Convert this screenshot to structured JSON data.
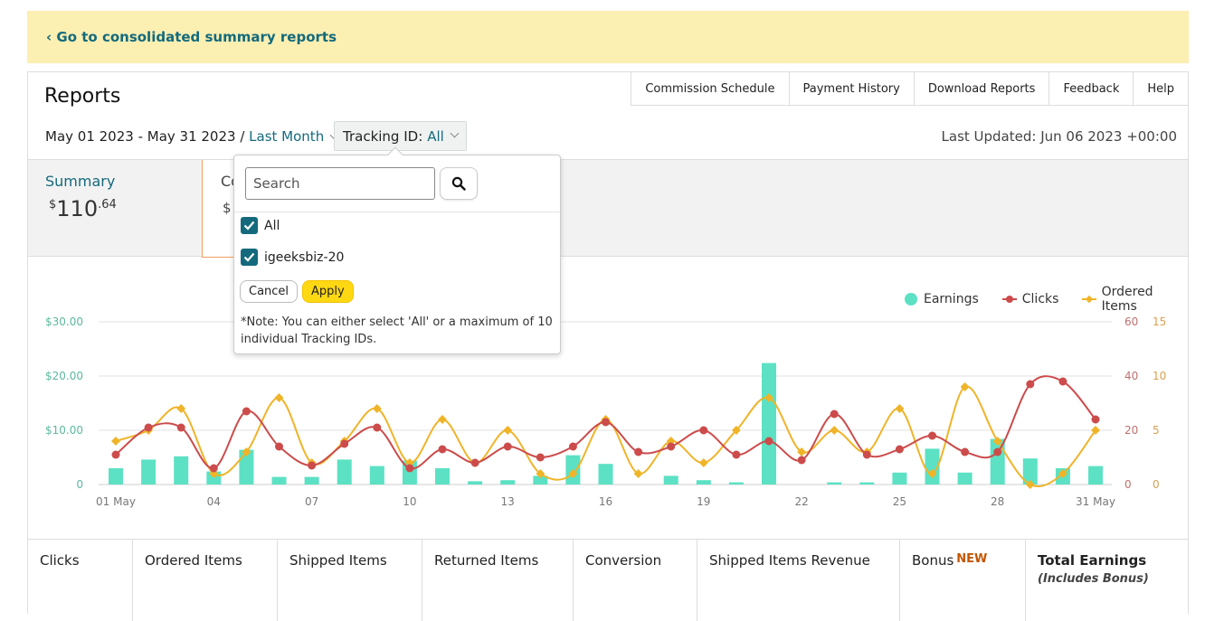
{
  "banner": {
    "link": "‹ Go to consolidated summary reports"
  },
  "header": {
    "title": "Reports",
    "nav": [
      "Commission Schedule",
      "Payment History",
      "Download Reports",
      "Feedback",
      "Help"
    ],
    "date_range": "May 01 2023 - May 31 2023 /",
    "period": "Last Month",
    "tracking_label": "Tracking ID:",
    "tracking_value": "All",
    "last_updated": "Last Updated: Jun 06 2023 +00:00"
  },
  "summary": {
    "tab_label": "Summary",
    "currency": "$",
    "amount_whole": "110",
    "amount_cents": ".64",
    "second_tab_label": "Co",
    "second_tab_value": "$"
  },
  "dropdown": {
    "search_placeholder": "Search",
    "options": [
      {
        "label": "All",
        "checked": true
      },
      {
        "label": "igeeksbiz-20",
        "checked": true
      }
    ],
    "cancel": "Cancel",
    "apply": "Apply",
    "note": "*Note: You can either select 'All' or a maximum of 10 individual Tracking IDs."
  },
  "legend": {
    "earnings": "Earnings",
    "clicks": "Clicks",
    "ordered": "Ordered Items"
  },
  "colors": {
    "earnings": "#5ce1c4",
    "clicks": "#cc4b4b",
    "ordered": "#f0b429",
    "link": "#146a7c",
    "banner": "#fcefb2"
  },
  "chart_data": {
    "type": "bar",
    "x_ticks": [
      "01 May",
      "04",
      "07",
      "10",
      "13",
      "16",
      "19",
      "22",
      "25",
      "28",
      "31 May"
    ],
    "y_left_ticks": [
      "0",
      "$10.00",
      "$20.00",
      "$30.00"
    ],
    "y_left_range": [
      0,
      30
    ],
    "y_right1_ticks": [
      "0",
      "20",
      "40",
      "60"
    ],
    "y_right1_range": [
      0,
      60
    ],
    "y_right2_ticks": [
      "0",
      "5",
      "10",
      "15"
    ],
    "y_right2_range": [
      0,
      15
    ],
    "days": [
      1,
      2,
      3,
      4,
      5,
      6,
      7,
      8,
      9,
      10,
      11,
      12,
      13,
      14,
      15,
      16,
      17,
      18,
      19,
      20,
      21,
      22,
      23,
      24,
      25,
      26,
      27,
      28,
      29,
      30,
      31
    ],
    "series": [
      {
        "name": "Earnings",
        "axis": "left",
        "values": [
          3.0,
          4.6,
          5.2,
          2.4,
          6.4,
          1.4,
          1.4,
          4.6,
          3.4,
          4.4,
          3.0,
          0.6,
          0.8,
          1.6,
          5.4,
          3.8,
          0,
          1.6,
          0.8,
          0.4,
          22.4,
          0,
          0.4,
          0.4,
          2.2,
          6.6,
          2.2,
          8.4,
          4.8,
          3.0,
          3.4
        ]
      },
      {
        "name": "Clicks",
        "axis": "right1",
        "values": [
          11,
          21,
          21,
          6,
          27,
          14,
          7,
          15,
          21,
          6,
          13,
          8,
          14,
          10,
          14,
          23,
          12,
          14,
          20,
          11,
          16,
          9,
          26,
          11,
          13,
          18,
          12,
          12,
          37,
          38,
          24
        ]
      },
      {
        "name": "Ordered Items",
        "axis": "right2",
        "values": [
          4,
          5,
          7,
          1,
          3,
          8,
          2,
          4,
          7,
          2,
          6,
          2,
          5,
          1,
          1,
          6,
          1,
          4,
          2,
          5,
          8,
          3,
          5,
          3,
          7,
          1,
          9,
          4,
          0,
          1,
          5
        ]
      }
    ]
  },
  "stats": {
    "clicks": "Clicks",
    "ordered": "Ordered Items",
    "shipped": "Shipped Items",
    "returned": "Returned Items",
    "conversion": "Conversion",
    "revenue": "Shipped Items Revenue",
    "bonus": "Bonus",
    "bonus_badge": "NEW",
    "total": "Total Earnings",
    "total_sub": "(Includes Bonus)"
  }
}
